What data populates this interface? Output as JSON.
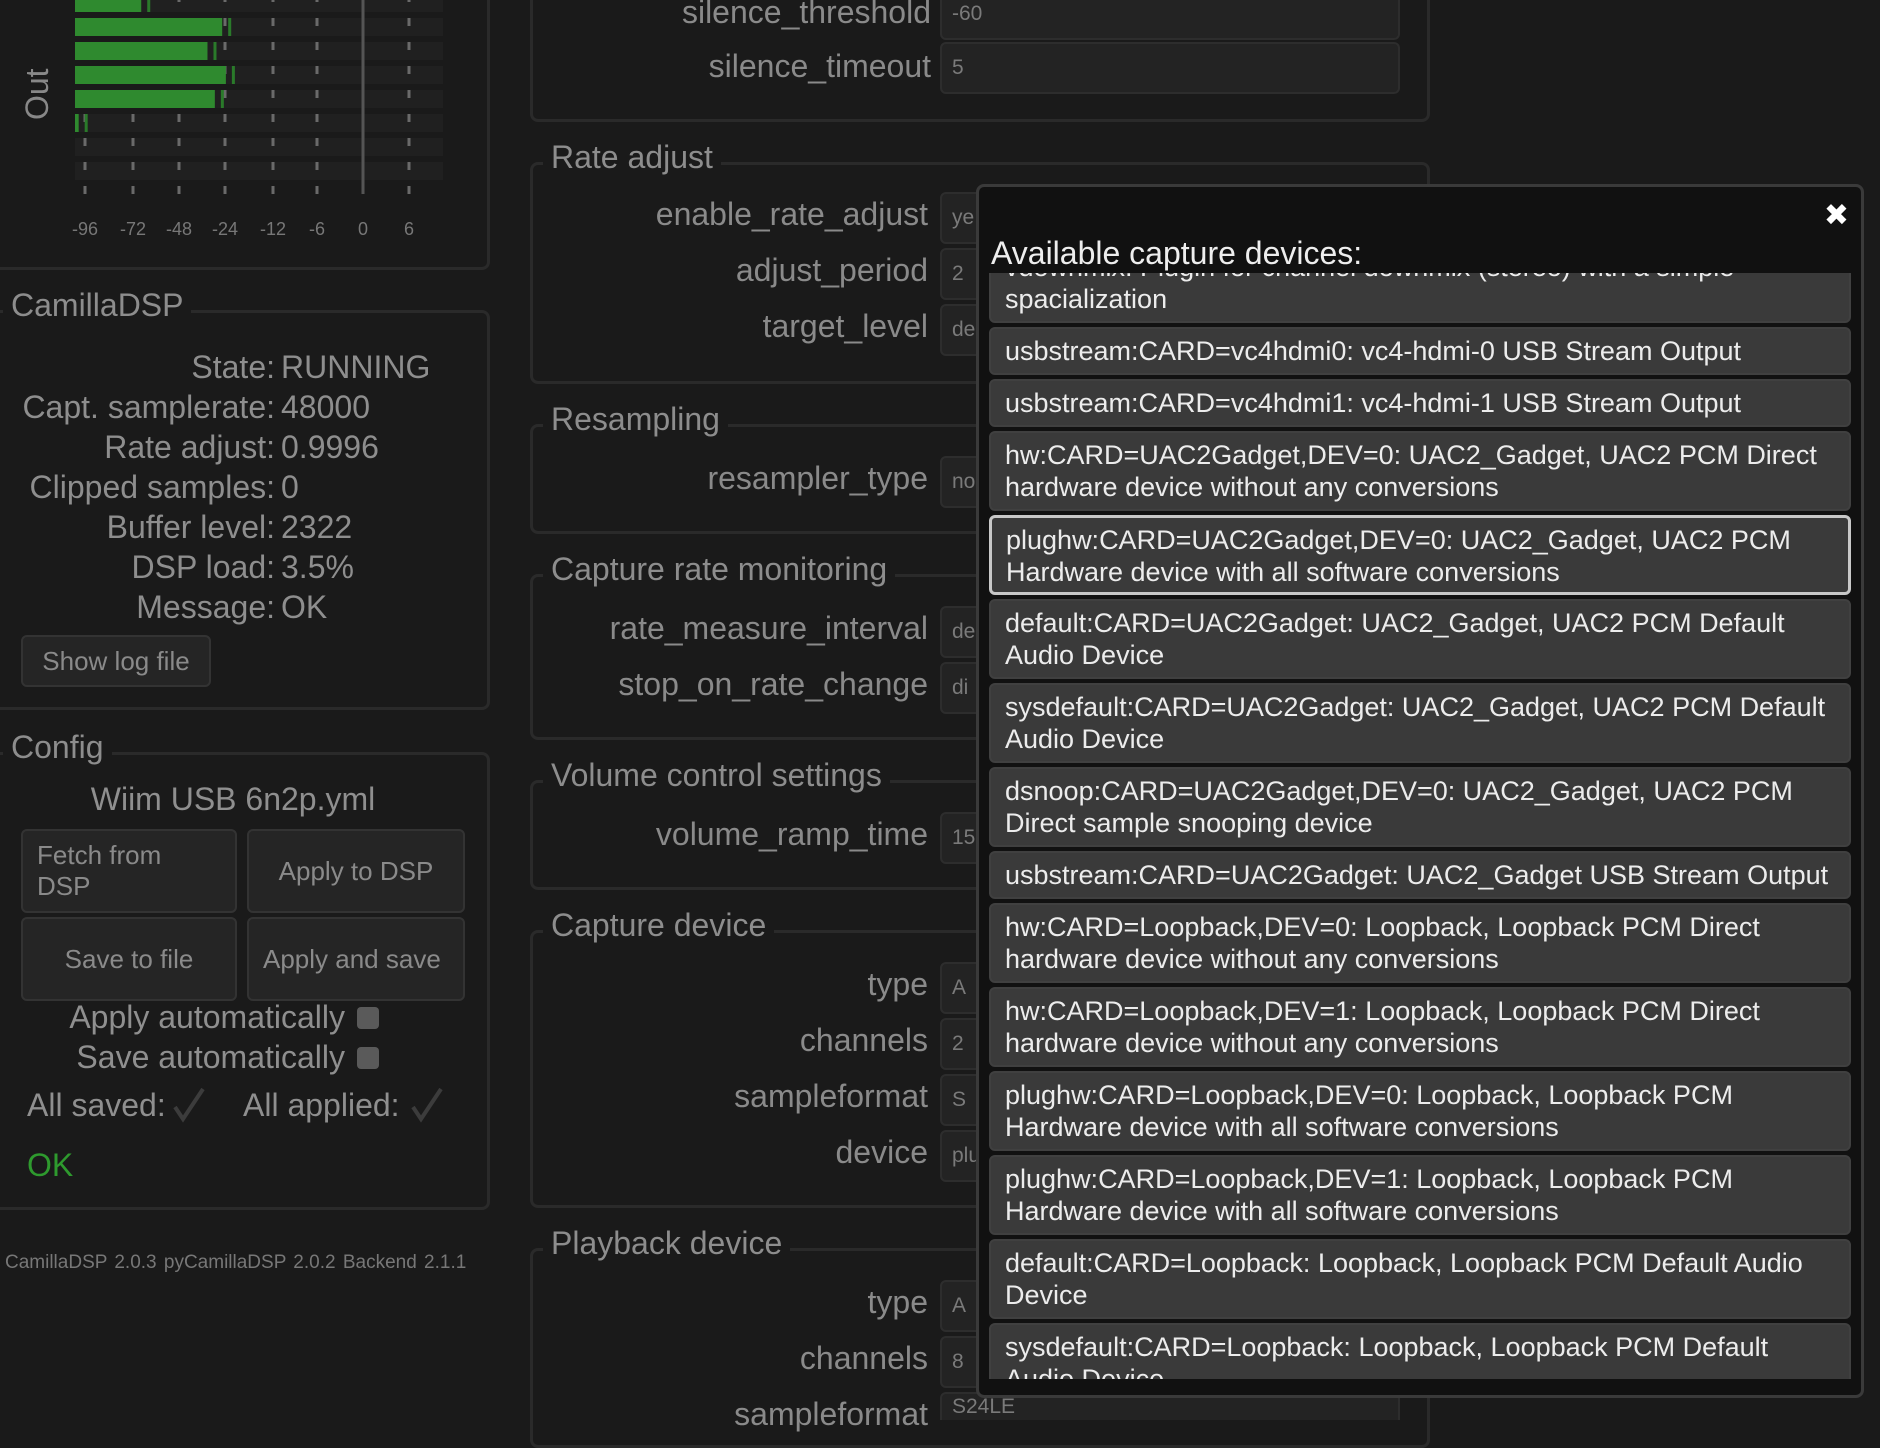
{
  "meter": {
    "label": "Out",
    "ticks": [
      "-96",
      "-72",
      "-48",
      "-24",
      "-12",
      "-6",
      "0",
      "6"
    ],
    "bar_levels": [
      0.18,
      0.4,
      0.36,
      0.41,
      0.38,
      0.01
    ],
    "bar_color": "#2f8a2f"
  },
  "camilladsp": {
    "title": "CamillaDSP",
    "rows": [
      {
        "k": "State:",
        "v": "RUNNING"
      },
      {
        "k": "Capt. samplerate:",
        "v": "48000"
      },
      {
        "k": "Rate adjust:",
        "v": "0.9996"
      },
      {
        "k": "Clipped samples:",
        "v": "0"
      },
      {
        "k": "Buffer level:",
        "v": "2322"
      },
      {
        "k": "DSP load:",
        "v": "3.5%"
      },
      {
        "k": "Message:",
        "v": "OK"
      }
    ],
    "show_log": "Show log file"
  },
  "config": {
    "title": "Config",
    "filename": "Wiim USB 6n2p.yml",
    "fetch": "Fetch from DSP",
    "apply": "Apply to DSP",
    "save": "Save to file",
    "apply_save": "Apply and save",
    "apply_auto": "Apply automatically",
    "save_auto": "Save automatically",
    "all_saved": "All saved:",
    "all_applied": "All applied:",
    "status": "OK",
    "status_color": "#2e9a2e"
  },
  "footer": "CamillaDSP 2.0.3   pyCamillaDSP 2.0.2   Backend 2.1.1",
  "middle": {
    "silence": {
      "silence_threshold": "silence_threshold",
      "silence_threshold_val": "-60",
      "silence_timeout": "silence_timeout",
      "silence_timeout_val": "5"
    },
    "rate_adjust": {
      "title": "Rate adjust",
      "enable": "enable_rate_adjust",
      "enable_val": "ye",
      "period": "adjust_period",
      "period_val": "2",
      "target": "target_level",
      "target_val": "de"
    },
    "resampling": {
      "title": "Resampling",
      "type": "resampler_type",
      "type_val": "no"
    },
    "capture_rate": {
      "title": "Capture rate monitoring",
      "interval": "rate_measure_interval",
      "interval_val": "de",
      "stop": "stop_on_rate_change",
      "stop_val": "di"
    },
    "volume": {
      "title": "Volume control settings",
      "ramp": "volume_ramp_time",
      "ramp_val": "15"
    },
    "capture": {
      "title": "Capture device",
      "type": "type",
      "type_val": "A",
      "channels": "channels",
      "channels_val": "2",
      "format": "sampleformat",
      "format_val": "S",
      "device": "device",
      "device_val": "plu"
    },
    "playback": {
      "title": "Playback device",
      "type": "type",
      "type_val": "A",
      "channels": "channels",
      "channels_val": "8",
      "format": "sampleformat",
      "format_val": "S24LE"
    }
  },
  "modal": {
    "title": "Available capture devices:",
    "close": "✖",
    "devices": [
      {
        "text": "vdownmix: Plugin for channel downmix (stereo) with a simple spacialization",
        "lines": 2
      },
      {
        "text": "usbstream:CARD=vc4hdmi0: vc4-hdmi-0 USB Stream Output",
        "lines": 1
      },
      {
        "text": "usbstream:CARD=vc4hdmi1: vc4-hdmi-1 USB Stream Output",
        "lines": 1
      },
      {
        "text": "hw:CARD=UAC2Gadget,DEV=0: UAC2_Gadget, UAC2 PCM Direct hardware device without any conversions",
        "lines": 2
      },
      {
        "text": "plughw:CARD=UAC2Gadget,DEV=0: UAC2_Gadget, UAC2 PCM Hardware device with all software conversions",
        "lines": 2,
        "selected": true
      },
      {
        "text": "default:CARD=UAC2Gadget: UAC2_Gadget, UAC2 PCM Default Audio Device",
        "lines": 2
      },
      {
        "text": "sysdefault:CARD=UAC2Gadget: UAC2_Gadget, UAC2 PCM Default Audio Device",
        "lines": 2
      },
      {
        "text": "dsnoop:CARD=UAC2Gadget,DEV=0: UAC2_Gadget, UAC2 PCM Direct sample snooping device",
        "lines": 2
      },
      {
        "text": "usbstream:CARD=UAC2Gadget: UAC2_Gadget USB Stream Output",
        "lines": 1
      },
      {
        "text": "hw:CARD=Loopback,DEV=0: Loopback, Loopback PCM Direct hardware device without any conversions",
        "lines": 2
      },
      {
        "text": "hw:CARD=Loopback,DEV=1: Loopback, Loopback PCM Direct hardware device without any conversions",
        "lines": 2
      },
      {
        "text": "plughw:CARD=Loopback,DEV=0: Loopback, Loopback PCM Hardware device with all software conversions",
        "lines": 2
      },
      {
        "text": "plughw:CARD=Loopback,DEV=1: Loopback, Loopback PCM Hardware device with all software conversions",
        "lines": 2
      },
      {
        "text": "default:CARD=Loopback: Loopback, Loopback PCM Default Audio Device",
        "lines": 2
      },
      {
        "text": "sysdefault:CARD=Loopback: Loopback, Loopback PCM Default Audio Device",
        "lines": 2
      }
    ]
  }
}
